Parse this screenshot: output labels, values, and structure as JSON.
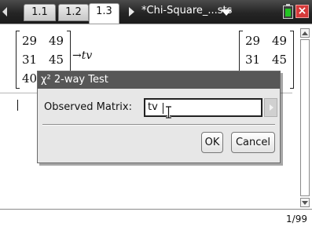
{
  "tabs": [
    {
      "label": "1.1"
    },
    {
      "label": "1.2"
    },
    {
      "label": "1.3"
    }
  ],
  "document": {
    "title": "*Chi-Square_...sts"
  },
  "calculator": {
    "left_matrix": {
      "rows": [
        [
          "29",
          "49"
        ],
        [
          "31",
          "45"
        ],
        [
          "40",
          ""
        ]
      ]
    },
    "store_expression": "→tv",
    "right_matrix": {
      "rows": [
        [
          "29",
          "49"
        ],
        [
          "31",
          "45"
        ],
        [
          "",
          ""
        ]
      ]
    }
  },
  "dialog": {
    "title": "χ² 2-way Test",
    "observed_label": "Observed Matrix:",
    "observed_value": "tv",
    "ok_label": "OK",
    "cancel_label": "Cancel"
  },
  "status": {
    "page_count": "1/99"
  },
  "colors": {
    "topbar": "#2b2b2b",
    "dialog_titlebar": "#575757",
    "dialog_body": "#e7e7e7",
    "battery": "#23c423",
    "close": "#d63a3a"
  },
  "icons": {
    "nav_left": "triangle-left",
    "nav_right": "triangle-right",
    "doc_menu": "triangle-down",
    "battery": "battery-icon",
    "close": "close-icon"
  }
}
